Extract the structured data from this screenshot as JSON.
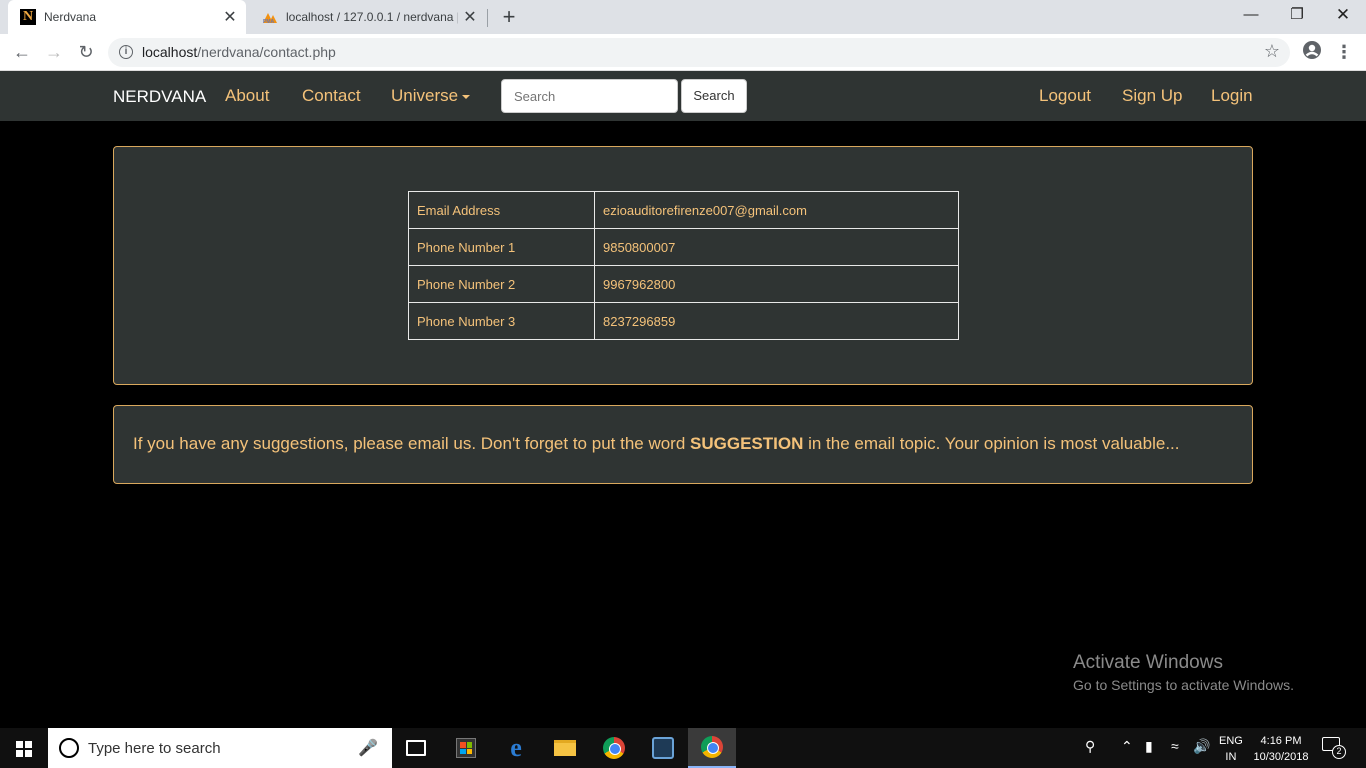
{
  "browser": {
    "tabs": [
      {
        "title": "Nerdvana",
        "favicon": "N",
        "active": true
      },
      {
        "title": "localhost / 127.0.0.1 / nerdvana | ",
        "favicon": "pma",
        "active": false
      }
    ],
    "close_glyph": "✕",
    "new_tab_glyph": "+",
    "url_host": "localhost",
    "url_path": "/nerdvana/contact.php"
  },
  "navbar": {
    "brand": "NERDVANA",
    "links": [
      "About",
      "Contact",
      "Universe"
    ],
    "search_placeholder": "Search",
    "search_button": "Search",
    "right_links": [
      "Logout",
      "Sign Up",
      "Login"
    ]
  },
  "contact": {
    "rows": [
      {
        "label": "Email Address",
        "value": "ezioauditorefirenze007@gmail.com"
      },
      {
        "label": "Phone Number 1",
        "value": "9850800007"
      },
      {
        "label": "Phone Number 2",
        "value": "9967962800"
      },
      {
        "label": "Phone Number 3",
        "value": "8237296859"
      }
    ]
  },
  "suggestion": {
    "before": "If you have any suggestions, please email us. Don't forget to put the word ",
    "keyword": "SUGGESTION",
    "after": " in the email topic. Your opinion is most valuable..."
  },
  "watermark": {
    "title": "Activate Windows",
    "subtitle": "Go to Settings to activate Windows."
  },
  "taskbar": {
    "search_placeholder": "Type here to search",
    "lang_line1": "ENG",
    "lang_line2": "IN",
    "time": "4:16 PM",
    "date": "10/30/2018",
    "notification_count": "2"
  },
  "colors": {
    "accent": "#f4c27a",
    "panel_bg": "#2f3433",
    "panel_border": "#d9a85d",
    "page_bg": "#000000"
  }
}
